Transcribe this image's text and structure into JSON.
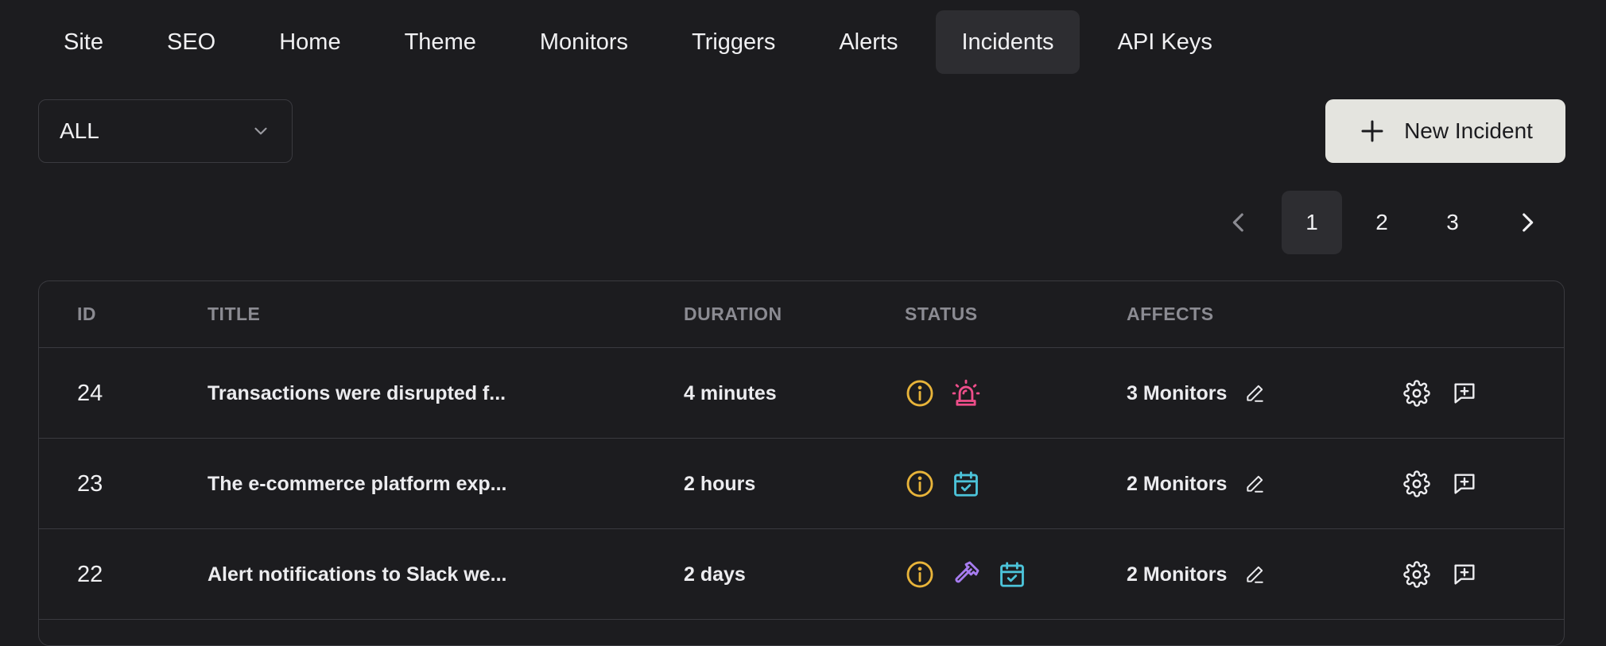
{
  "nav": {
    "tabs": [
      {
        "label": "Site"
      },
      {
        "label": "SEO"
      },
      {
        "label": "Home"
      },
      {
        "label": "Theme"
      },
      {
        "label": "Monitors"
      },
      {
        "label": "Triggers"
      },
      {
        "label": "Alerts"
      },
      {
        "label": "Incidents",
        "active": true
      },
      {
        "label": "API Keys"
      }
    ]
  },
  "filter": {
    "selected": "ALL"
  },
  "actions": {
    "new_incident_label": "New Incident"
  },
  "pagination": {
    "pages": [
      "1",
      "2",
      "3"
    ],
    "current": "1"
  },
  "table": {
    "headers": {
      "id": "ID",
      "title": "TITLE",
      "duration": "DURATION",
      "status": "STATUS",
      "affects": "AFFECTS"
    },
    "rows": [
      {
        "id": "24",
        "title": "Transactions were disrupted f...",
        "duration": "4 minutes",
        "status_icons": [
          "info-icon",
          "siren-icon"
        ],
        "affects": "3 Monitors"
      },
      {
        "id": "23",
        "title": "The e-commerce platform exp...",
        "duration": "2 hours",
        "status_icons": [
          "info-icon",
          "calendar-check-icon"
        ],
        "affects": "2 Monitors"
      },
      {
        "id": "22",
        "title": "Alert notifications to Slack we...",
        "duration": "2 days",
        "status_icons": [
          "info-icon",
          "hammer-icon",
          "calendar-check-icon"
        ],
        "affects": "2 Monitors"
      }
    ]
  },
  "colors": {
    "background": "#1c1c1f",
    "active_tab": "#2d2d31",
    "border": "#3a3a3f",
    "button_bg": "#e4e4df",
    "info": "#e8b43a",
    "siren": "#ee4e8a",
    "calendar": "#4cc3d9",
    "hammer": "#a77cf0"
  }
}
